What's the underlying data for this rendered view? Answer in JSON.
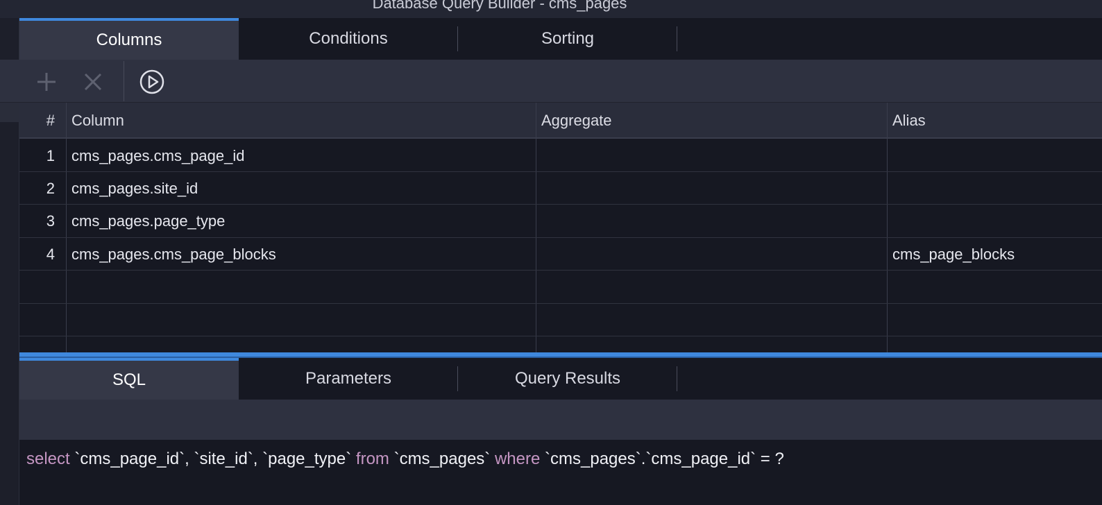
{
  "window": {
    "title": "Database Query Builder - cms_pages"
  },
  "top_tabs": [
    {
      "label": "Columns",
      "active": true
    },
    {
      "label": "Conditions",
      "active": false
    },
    {
      "label": "Sorting",
      "active": false
    }
  ],
  "toolbar": {
    "add_icon": "plus-icon",
    "remove_icon": "close-icon",
    "run_icon": "play-circle-icon"
  },
  "grid": {
    "headers": {
      "num": "#",
      "column": "Column",
      "aggregate": "Aggregate",
      "alias": "Alias"
    },
    "rows": [
      {
        "num": "1",
        "column": "cms_pages.cms_page_id",
        "aggregate": "",
        "alias": ""
      },
      {
        "num": "2",
        "column": "cms_pages.site_id",
        "aggregate": "",
        "alias": ""
      },
      {
        "num": "3",
        "column": "cms_pages.page_type",
        "aggregate": "",
        "alias": ""
      },
      {
        "num": "4",
        "column": "cms_pages.cms_page_blocks",
        "aggregate": "",
        "alias": "cms_page_blocks"
      }
    ]
  },
  "bottom_tabs": [
    {
      "label": "SQL",
      "active": true
    },
    {
      "label": "Parameters",
      "active": false
    },
    {
      "label": "Query Results",
      "active": false
    }
  ],
  "sql": {
    "kw_select": "select",
    "part1": " `cms_page_id`, `site_id`, `page_type` ",
    "kw_from": "from",
    "part2": " `cms_pages` ",
    "kw_where": "where",
    "part3": " `cms_pages`.`cms_page_id` = ?"
  },
  "colors": {
    "accent": "#3f88dd",
    "keyword": "#c596c3",
    "background": "#161822"
  }
}
